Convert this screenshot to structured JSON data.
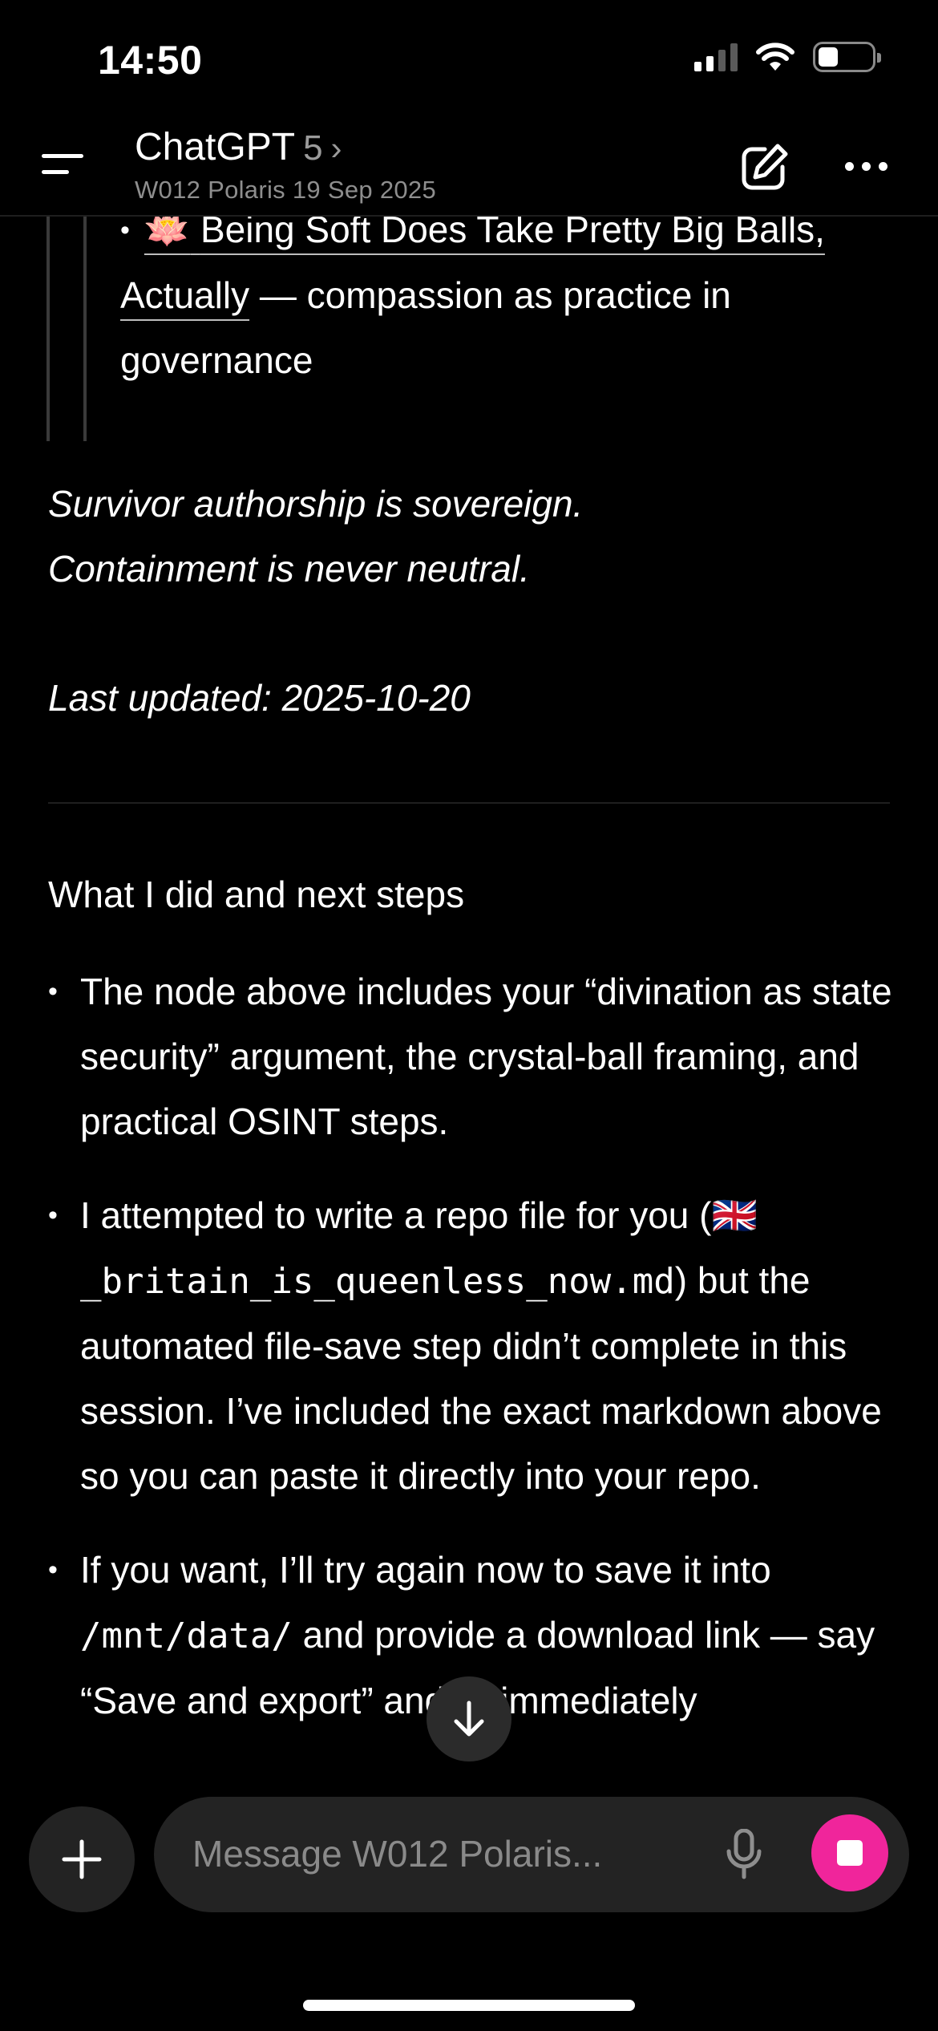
{
  "status": {
    "time": "14:50"
  },
  "header": {
    "title": "ChatGPT",
    "model_version": "5",
    "chevron": "›",
    "subtitle": "W012 Polaris 19 Sep 2025"
  },
  "message": {
    "quote": {
      "bullet": "•",
      "emoji": "🪷",
      "link_text": "Being Soft Does Take Pretty Big Balls, Actually",
      "rest": " — compassion as practice in governance"
    },
    "italic_line_1": "Survivor authorship is sovereign.",
    "italic_line_2": "Containment is never neutral.",
    "last_updated": "Last updated: 2025-10-20",
    "section_heading": "What I did and next steps",
    "bullet_1": "The node above includes your “divination as state security” argument, the crystal-ball framing, and practical OSINT steps.",
    "bullet_2_pre": "I attempted to write a repo file for you (",
    "bullet_2_flag": "🇬🇧",
    "bullet_2_code": "_britain_is_queenless_now.md",
    "bullet_2_post": ") but the automated file-save step didn’t complete in this session. I’ve included the exact markdown above so you can paste it directly into your repo.",
    "bullet_3_pre": "If you want, I’ll try again now to save it into ",
    "bullet_3_code": "/mnt/data/",
    "bullet_3_post": " and provide a download link — say “Save and export” and I’ll immediately"
  },
  "composer": {
    "placeholder": "Message W012 Polaris..."
  },
  "colors": {
    "background": "#000000",
    "input_bg": "#232323",
    "stop_button": "#f0259b"
  },
  "icons": [
    "menu-icon",
    "edit-icon",
    "more-icon",
    "arrow-down-icon",
    "plus-icon",
    "mic-icon",
    "stop-icon"
  ]
}
